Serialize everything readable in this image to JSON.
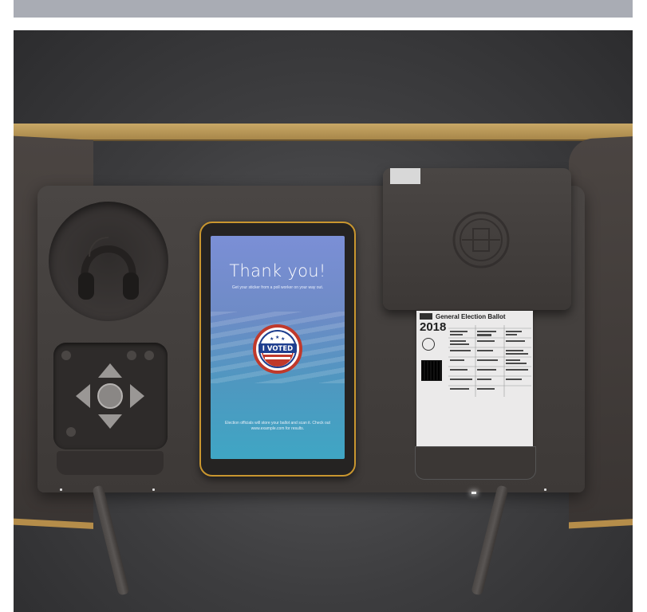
{
  "screen": {
    "title": "Thank you!",
    "subtitle": "Get your sticker from a poll worker on your way out.",
    "footer": "Election officials will store your ballot and scan it. Check out www.example.com for results.",
    "sticker_text": "I VOTED"
  },
  "ballot": {
    "title": "General Election Ballot",
    "year": "2018"
  },
  "colors": {
    "tablet_border": "#c9962f",
    "cork": "#c8a866",
    "booth": "#4a4644",
    "screen_top": "#7b8fd6",
    "screen_bottom": "#3fa6c4",
    "sticker_red": "#c0392b",
    "sticker_blue": "#1f3f8f"
  },
  "icons": [
    "headphones-icon",
    "arrow-up-icon",
    "arrow-down-icon",
    "arrow-left-icon",
    "arrow-right-icon",
    "select-button-icon",
    "seal-icon",
    "qr-code-icon"
  ]
}
